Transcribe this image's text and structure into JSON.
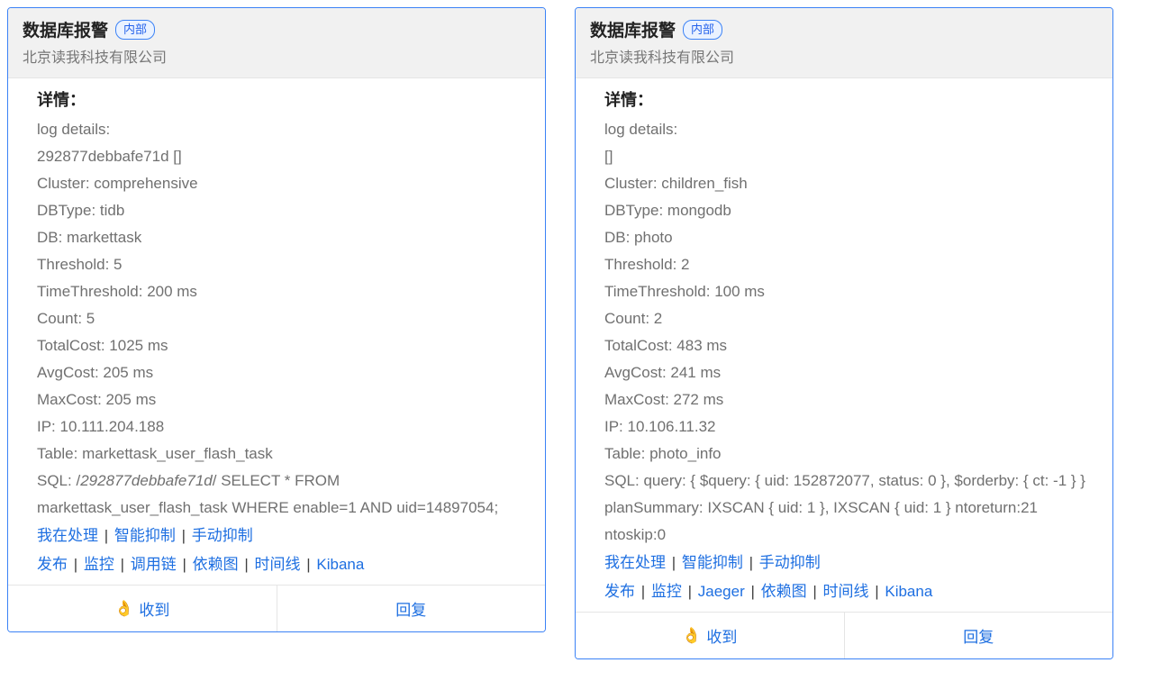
{
  "cards": [
    {
      "title": "数据库报警",
      "badge": "内部",
      "subtitle": "北京读我科技有限公司",
      "detailHeading": "详情：",
      "sqlLabel": "SQL: ",
      "sqlPrefix": "/",
      "sqlHash": "292877debbafe71d",
      "sqlSuffix": "/",
      "sqlBody": " SELECT * FROM markettask_user_flash_task WHERE enable=1 AND uid=14897054;",
      "lines": [
        "log details:",
        "292877debbafe71d []",
        "Cluster: comprehensive",
        "DBType: tidb",
        "DB: markettask",
        "Threshold: 5",
        "TimeThreshold: 200 ms",
        "Count: 5",
        "TotalCost: 1025 ms",
        "AvgCost: 205 ms",
        "MaxCost: 205 ms",
        "IP: 10.111.204.188",
        "Table: markettask_user_flash_task"
      ],
      "linksRow1": [
        "我在处理",
        "智能抑制",
        "手动抑制"
      ],
      "linksRow2": [
        "发布",
        "监控",
        "调用链",
        "依赖图",
        "时间线",
        "Kibana"
      ],
      "footer": {
        "left": "收到",
        "right": "回复",
        "emoji": "👌"
      }
    },
    {
      "title": "数据库报警",
      "badge": "内部",
      "subtitle": "北京读我科技有限公司",
      "detailHeading": "详情：",
      "sqlLabel": "",
      "sqlPrefix": "",
      "sqlHash": "",
      "sqlSuffix": "",
      "sqlBody": "SQL: query: { $query: { uid: 152872077, status: 0 }, $orderby: { ct: -1 } } planSummary: IXSCAN { uid: 1 }, IXSCAN { uid: 1 } ntoreturn:21 ntoskip:0",
      "lines": [
        "log details:",
        "[]",
        "Cluster: children_fish",
        "DBType: mongodb",
        "DB: photo",
        "Threshold: 2",
        "TimeThreshold: 100 ms",
        "Count: 2",
        "TotalCost: 483 ms",
        "AvgCost: 241 ms",
        "MaxCost: 272 ms",
        "IP: 10.106.11.32",
        "Table: photo_info"
      ],
      "linksRow1": [
        "我在处理",
        "智能抑制",
        "手动抑制"
      ],
      "linksRow2": [
        "发布",
        "监控",
        "Jaeger",
        "依赖图",
        "时间线",
        "Kibana"
      ],
      "footer": {
        "left": "收到",
        "right": "回复",
        "emoji": "👌"
      }
    }
  ]
}
